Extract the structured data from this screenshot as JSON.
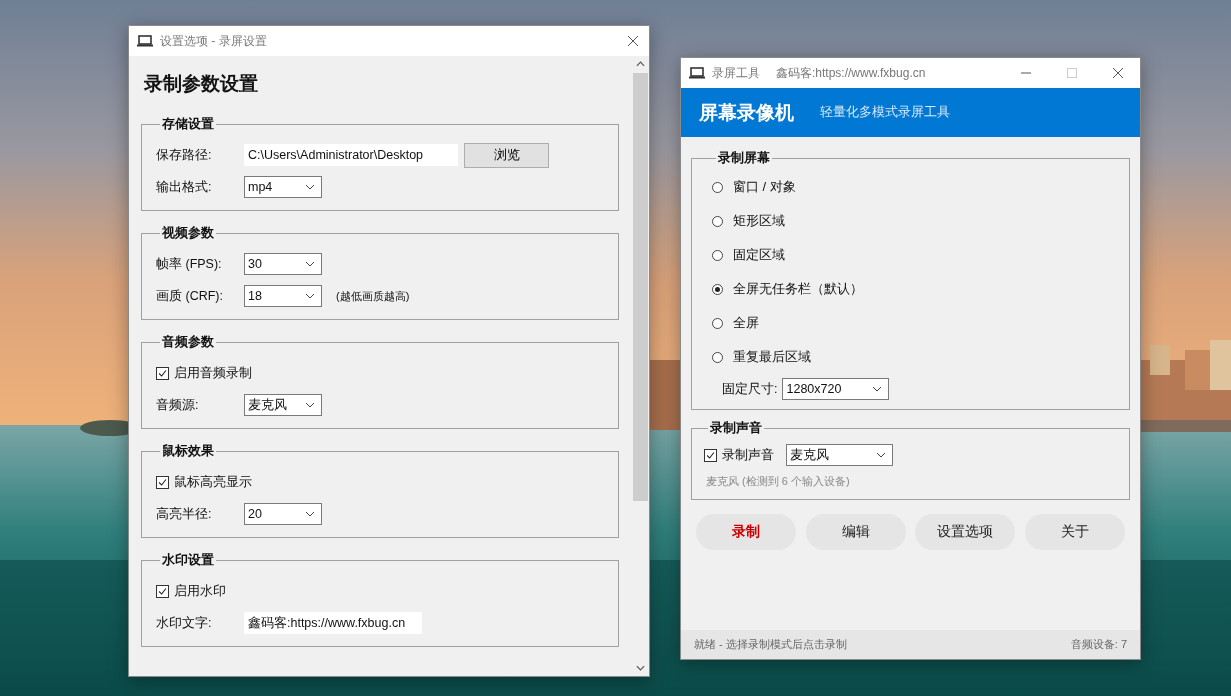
{
  "settings_window": {
    "title": "设置选项 - 录屏设置",
    "heading": "录制参数设置",
    "groups": [
      {
        "title": "存储设置",
        "rows": [
          {
            "kind": "path",
            "label": "保存路径:",
            "value": "C:\\Users\\Administrator\\Desktop",
            "button": "浏览"
          },
          {
            "kind": "select",
            "label": "输出格式:",
            "value": "mp4"
          }
        ]
      },
      {
        "title": "视频参数",
        "rows": [
          {
            "kind": "select",
            "label": "帧率 (FPS):",
            "value": "30"
          },
          {
            "kind": "select",
            "label": "画质 (CRF):",
            "value": "18",
            "note": "(越低画质越高)"
          }
        ]
      },
      {
        "title": "音频参数",
        "rows": [
          {
            "kind": "checkbox",
            "label": "启用音频录制",
            "checked": true
          },
          {
            "kind": "select",
            "label": "音频源:",
            "value": "麦克风"
          }
        ]
      },
      {
        "title": "鼠标效果",
        "rows": [
          {
            "kind": "checkbox",
            "label": "鼠标高亮显示",
            "checked": true
          },
          {
            "kind": "select",
            "label": "高亮半径:",
            "value": "20"
          }
        ]
      },
      {
        "title": "水印设置",
        "rows": [
          {
            "kind": "checkbox",
            "label": "启用水印",
            "checked": true
          },
          {
            "kind": "text",
            "label": "水印文字:",
            "value": "鑫码客:https://www.fxbug.cn"
          }
        ]
      }
    ]
  },
  "recorder_window": {
    "title": "录屏工具",
    "subtitle": "鑫码客:https://www.fxbug.cn",
    "banner": {
      "title": "屏幕录像机",
      "tagline": "轻量化多模式录屏工具"
    },
    "screen_group": {
      "title": "录制屏幕",
      "modes": [
        {
          "label": "窗口 / 对象",
          "selected": false
        },
        {
          "label": "矩形区域",
          "selected": false
        },
        {
          "label": "固定区域",
          "selected": false
        },
        {
          "label": "全屏无任务栏（默认）",
          "selected": true
        },
        {
          "label": "全屏",
          "selected": false
        },
        {
          "label": "重复最后区域",
          "selected": false
        }
      ],
      "size_label": "固定尺寸:",
      "size_value": "1280x720"
    },
    "audio_group": {
      "title": "录制声音",
      "checkbox": {
        "label": "录制声音",
        "checked": true
      },
      "source": "麦克风",
      "hint": "麦克风 (检测到 6 个输入设备)"
    },
    "buttons": [
      {
        "label": "录制",
        "kind": "primary"
      },
      {
        "label": "编辑",
        "kind": "normal"
      },
      {
        "label": "设置选项",
        "kind": "normal"
      },
      {
        "label": "关于",
        "kind": "normal"
      }
    ],
    "status_bar": {
      "message": "就绪 - 选择录制模式后点击录制",
      "devices": "音频设备: 7"
    }
  }
}
